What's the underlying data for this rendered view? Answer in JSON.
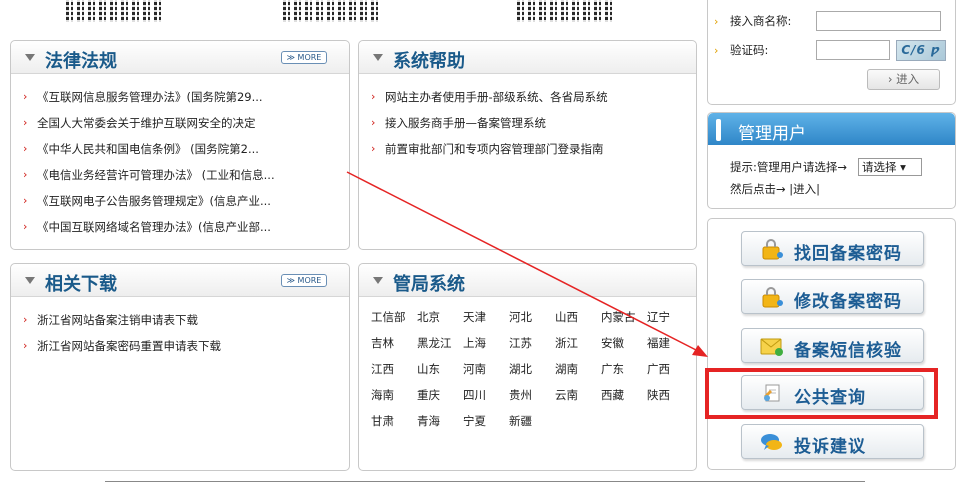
{
  "qr_codes": [
    "qr-code-1",
    "qr-code-2",
    "qr-code-3"
  ],
  "laws": {
    "title": "法律法规",
    "more": "≫ MORE",
    "items": [
      "《互联网信息服务管理办法》(国务院第29...",
      "全国人大常委会关于维护互联网安全的决定",
      "《中华人民共和国电信条例》 (国务院第2...",
      "《电信业务经营许可管理办法》 (工业和信息...",
      "《互联网电子公告服务管理规定》(信息产业...",
      "《中国互联网络域名管理办法》(信息产业部..."
    ]
  },
  "help": {
    "title": "系统帮助",
    "items": [
      "网站主办者使用手册-部级系统、各省局系统",
      "接入服务商手册—备案管理系统",
      "前置审批部门和专项内容管理部门登录指南"
    ]
  },
  "downloads": {
    "title": "相关下载",
    "more": "≫ MORE",
    "items": [
      "浙江省网站备案注销申请表下载",
      "浙江省网站备案密码重置申请表下载"
    ]
  },
  "bureaus": {
    "title": "管局系统",
    "cities": [
      "工信部",
      "北京",
      "天津",
      "河北",
      "山西",
      "内蒙古",
      "辽宁",
      "吉林",
      "黑龙江",
      "上海",
      "江苏",
      "浙江",
      "安徽",
      "福建",
      "江西",
      "山东",
      "河南",
      "湖北",
      "湖南",
      "广东",
      "广西",
      "海南",
      "重庆",
      "四川",
      "贵州",
      "云南",
      "西藏",
      "陕西",
      "甘肃",
      "青海",
      "宁夏",
      "新疆"
    ]
  },
  "login": {
    "isp_label": "接入商名称:",
    "captcha_label": "验证码:",
    "captcha_text": "C/6 ƿ",
    "enter": "› 进入"
  },
  "admin": {
    "title": "管理用户",
    "hint": "提示:管理用户请选择→",
    "select": "请选择 ▾",
    "then": "然后点击→ |进入|"
  },
  "services": [
    {
      "label": "找回备案密码",
      "icon": "lock-icon"
    },
    {
      "label": "修改备案密码",
      "icon": "lock-icon"
    },
    {
      "label": "备案短信核验",
      "icon": "sms-icon"
    },
    {
      "label": "公共查询",
      "icon": "document-icon"
    },
    {
      "label": "投诉建议",
      "icon": "chat-icon"
    }
  ],
  "colors": {
    "title_blue": "#1a5a8a",
    "bullet_red": "#d0201a",
    "highlight_red": "#e52424",
    "admin_header": "#2f86c8"
  }
}
